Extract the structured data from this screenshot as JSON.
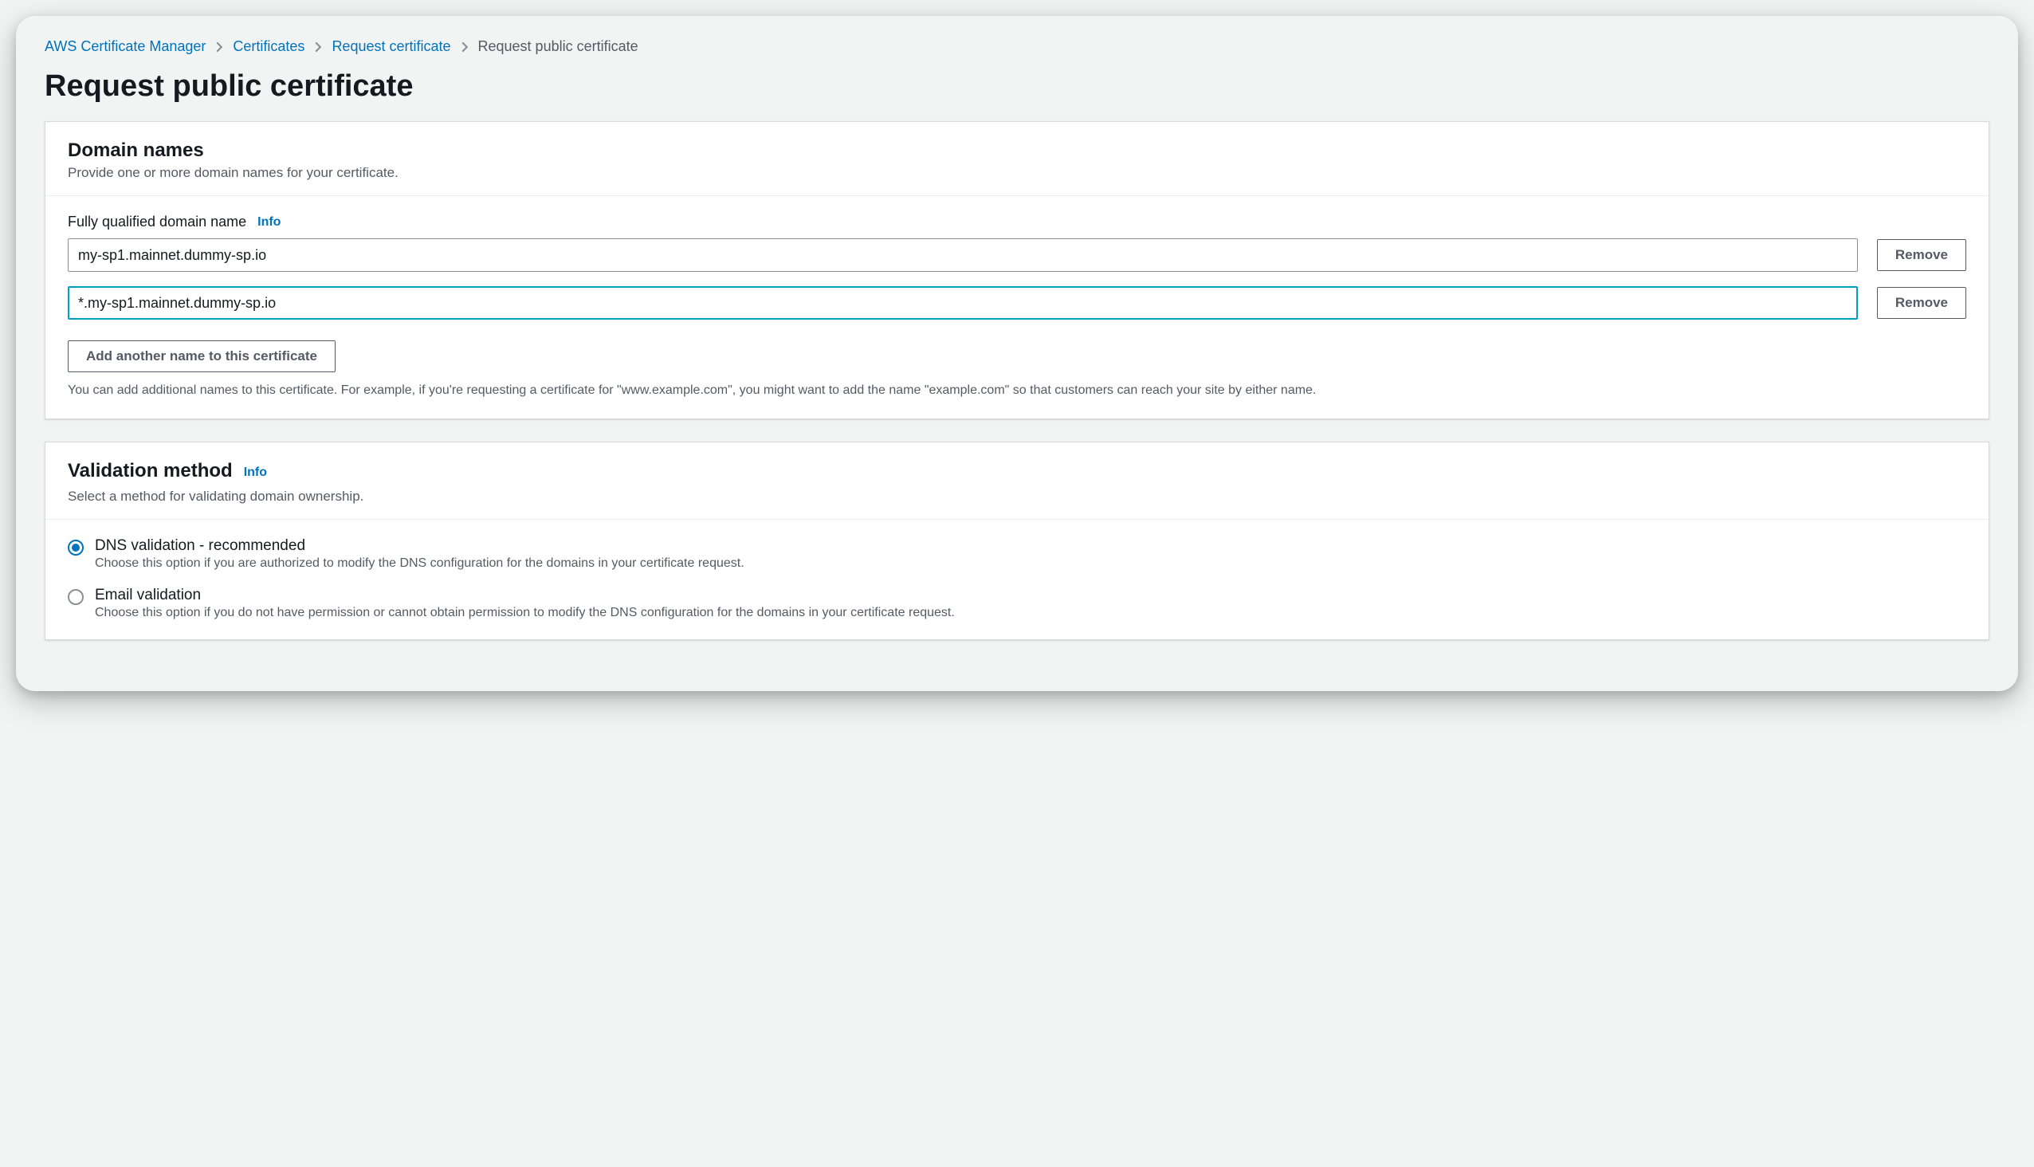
{
  "breadcrumb": {
    "items": [
      {
        "label": "AWS Certificate Manager"
      },
      {
        "label": "Certificates"
      },
      {
        "label": "Request certificate"
      }
    ],
    "current": "Request public certificate"
  },
  "page_title": "Request public certificate",
  "domain_section": {
    "title": "Domain names",
    "desc": "Provide one or more domain names for your certificate.",
    "field_label": "Fully qualified domain name",
    "info": "Info",
    "domains": [
      {
        "value": "my-sp1.mainnet.dummy-sp.io",
        "remove": "Remove"
      },
      {
        "value": "*.my-sp1.mainnet.dummy-sp.io",
        "remove": "Remove"
      }
    ],
    "add_button": "Add another name to this certificate",
    "helper": "You can add additional names to this certificate. For example, if you're requesting a certificate for \"www.example.com\", you might want to add the name \"example.com\" so that customers can reach your site by either name."
  },
  "validation_section": {
    "title": "Validation method",
    "info": "Info",
    "desc": "Select a method for validating domain ownership.",
    "options": [
      {
        "label": "DNS validation - recommended",
        "desc": "Choose this option if you are authorized to modify the DNS configuration for the domains in your certificate request.",
        "selected": true
      },
      {
        "label": "Email validation",
        "desc": "Choose this option if you do not have permission or cannot obtain permission to modify the DNS configuration for the domains in your certificate request.",
        "selected": false
      }
    ]
  }
}
